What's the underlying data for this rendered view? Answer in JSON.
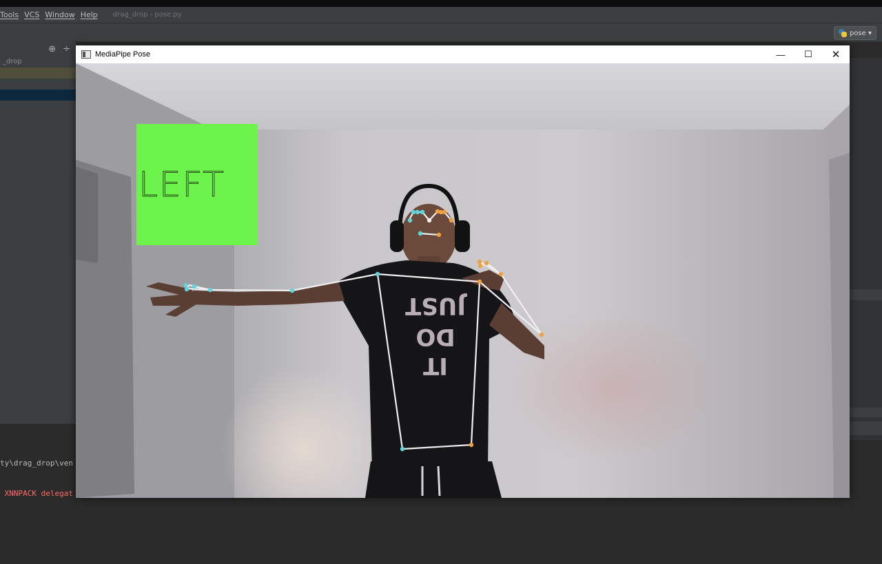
{
  "menubar": {
    "items": [
      "Tools",
      "VCS",
      "Window",
      "Help"
    ],
    "window_title": "drag_drop - pose.py"
  },
  "toolbar": {
    "run_config": "pose ▾"
  },
  "project": {
    "root_label": "_drop",
    "header_icons": [
      "crosshair-icon",
      "collapse-icon"
    ]
  },
  "console": {
    "lines": [
      "ty\\drag_drop\\ven",
      " XNNPACK delegat"
    ]
  },
  "window": {
    "title": "MediaPipe Pose",
    "minimize_glyph": "—",
    "maximize_glyph": "☐",
    "close_glyph": "✕"
  },
  "overlay": {
    "box_label": "LEFT",
    "box_color": "#6cf44c"
  },
  "colors": {
    "left_landmark": "#5ed6dc",
    "right_landmark": "#f0a040",
    "connection": "#f0f0f0",
    "ide_bg": "#2b2b2b",
    "panel_bg": "#3c3f41"
  }
}
